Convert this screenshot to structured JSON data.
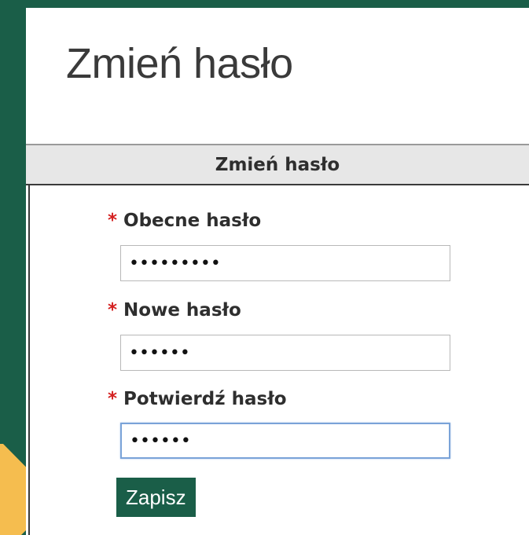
{
  "page": {
    "title": "Zmień hasło"
  },
  "form": {
    "section_title": "Zmień hasło",
    "required_marker": "*",
    "fields": [
      {
        "label": "Obecne hasło",
        "value": "•••••••••",
        "type": "password"
      },
      {
        "label": "Nowe hasło",
        "value": "••••••",
        "type": "password"
      },
      {
        "label": "Potwierdź hasło",
        "value": "••••••",
        "type": "password",
        "focused": true
      }
    ],
    "save_label": "Zapisz"
  },
  "colors": {
    "brand_green": "#1a5e48",
    "required_red": "#d42020",
    "pointer_yellow": "#f5bd4f",
    "focus_border": "#7aa3d8"
  },
  "icons": {
    "pointer": "triangle-arrow-right"
  }
}
